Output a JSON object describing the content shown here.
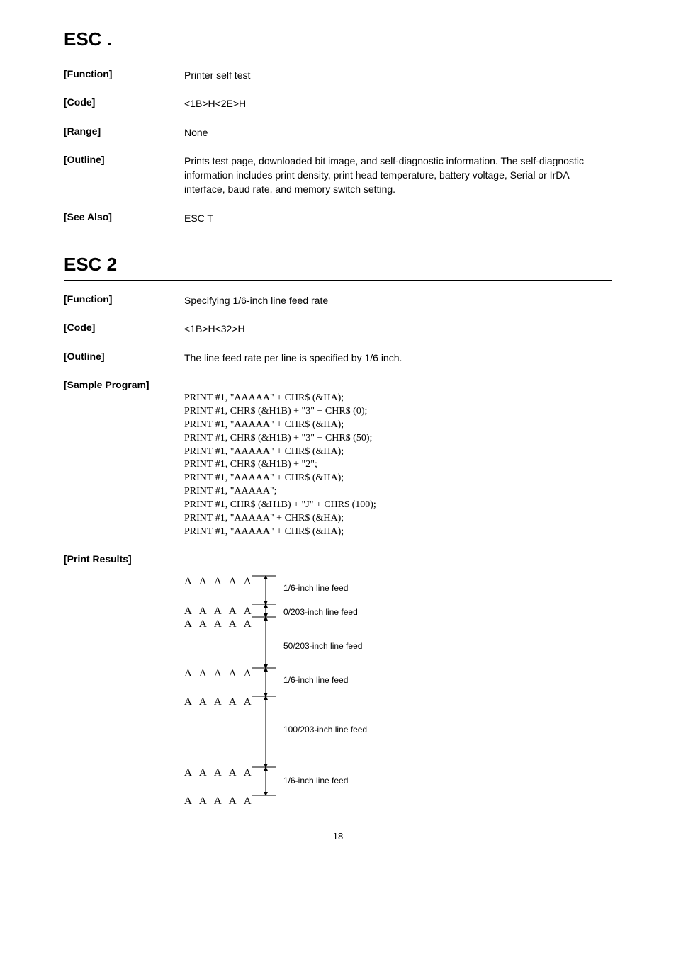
{
  "esc_dot": {
    "title": "ESC .",
    "rows": {
      "function_label": "[Function]",
      "function_value": "Printer self test",
      "code_label": "[Code]",
      "code_value": "<1B>H<2E>H",
      "range_label": "[Range]",
      "range_value": "None",
      "outline_label": "[Outline]",
      "outline_value": "Prints test page, downloaded bit image, and self-diagnostic information.  The self-diagnostic information includes print density, print head temperature, battery voltage, Serial or IrDA interface, baud rate, and memory switch setting.",
      "seealso_label": "[See Also]",
      "seealso_value": "ESC T"
    }
  },
  "esc_2": {
    "title": "ESC 2",
    "rows": {
      "function_label": "[Function]",
      "function_value": "Specifying 1/6-inch line feed rate",
      "code_label": "[Code]",
      "code_value": "<1B>H<32>H",
      "outline_label": "[Outline]",
      "outline_value": "The line feed rate per line is specified by 1/6 inch.",
      "sample_label": "[Sample Program]",
      "sample_lines": [
        "PRINT #1, \"AAAAA\" + CHR$ (&HA);",
        "PRINT #1, CHR$ (&H1B) + \"3\" + CHR$ (0);",
        "PRINT #1, \"AAAAA\" + CHR$ (&HA);",
        "PRINT #1, CHR$ (&H1B) + \"3\" + CHR$ (50);",
        "PRINT #1, \"AAAAA\" + CHR$ (&HA);",
        "PRINT #1, CHR$ (&H1B) + \"2\";",
        "PRINT #1, \"AAAAA\" + CHR$ (&HA);",
        "PRINT #1, \"AAAAA\";",
        "PRINT #1, CHR$ (&H1B) + \"J\" + CHR$ (100);",
        "PRINT #1, \"AAAAA\" + CHR$ (&HA);",
        "PRINT #1, \"AAAAA\" + CHR$ (&HA);"
      ],
      "print_label": "[Print Results]"
    },
    "diagram": {
      "aaaaa": "A A A A A",
      "lbl1": "1/6-inch line feed",
      "lbl2": "0/203-inch line feed",
      "lbl3": "50/203-inch line feed",
      "lbl4": "1/6-inch line feed",
      "lbl5": "100/203-inch line feed",
      "lbl6": "1/6-inch line feed"
    }
  },
  "pagenum": "— 18 —"
}
